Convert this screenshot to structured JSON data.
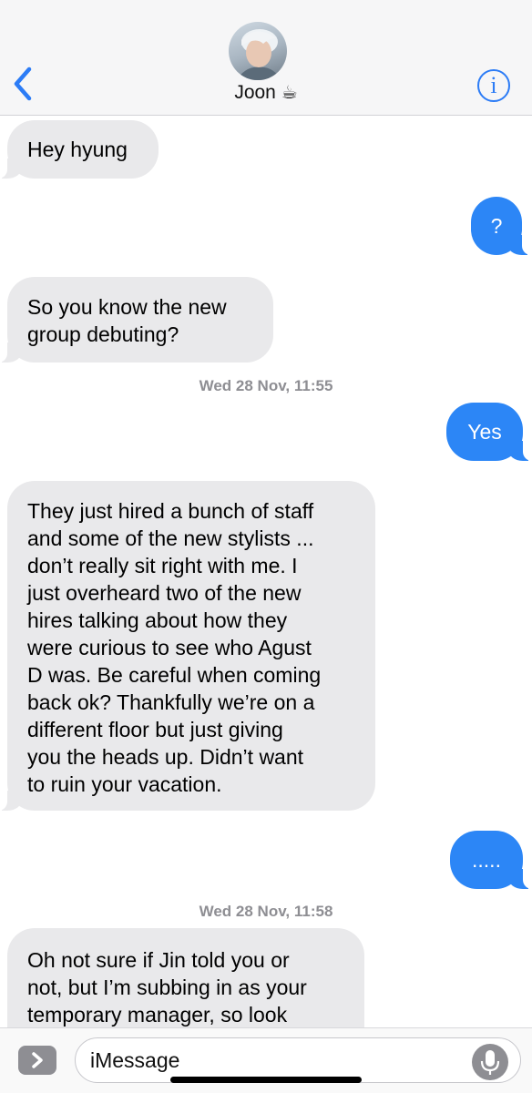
{
  "header": {
    "contact_name": "Joon",
    "contact_emoji": "☕",
    "info_label": "i"
  },
  "messages": [
    {
      "direction": "in",
      "text": "Hey hyung"
    },
    {
      "direction": "out",
      "text": "?"
    },
    {
      "direction": "in",
      "text": "So you know the new\ngroup debuting?"
    },
    {
      "type": "timestamp",
      "day": "Wed",
      "date": "28 Nov,",
      "time": "11:55"
    },
    {
      "direction": "out",
      "text": "Yes"
    },
    {
      "direction": "in",
      "text": "They just hired a bunch of staff\nand some of the new stylists ...\ndon’t really sit right with me. I\njust overheard two of the new\nhires talking about how they\nwere curious to see who Agust\nD was. Be careful when coming\nback ok? Thankfully we’re on a\ndifferent floor but just giving\nyou the heads up. Didn’t want\nto ruin your vacation."
    },
    {
      "direction": "out",
      "text": "....."
    },
    {
      "type": "timestamp",
      "day": "Wed",
      "date": "28 Nov,",
      "time": "11:58"
    },
    {
      "direction": "in",
      "text": "Oh not sure if Jin told you or\nnot, but I’m subbing in as your\ntemporary manager, so look"
    }
  ],
  "composer": {
    "placeholder": "iMessage",
    "apps_icon": "app-store-chevron-icon",
    "mic_icon": "microphone-icon"
  },
  "colors": {
    "accent": "#2c7cf6",
    "outgoing_bubble": "#2c86f6",
    "incoming_bubble": "#e9e9eb",
    "timestamp_text": "#8e8e93"
  }
}
